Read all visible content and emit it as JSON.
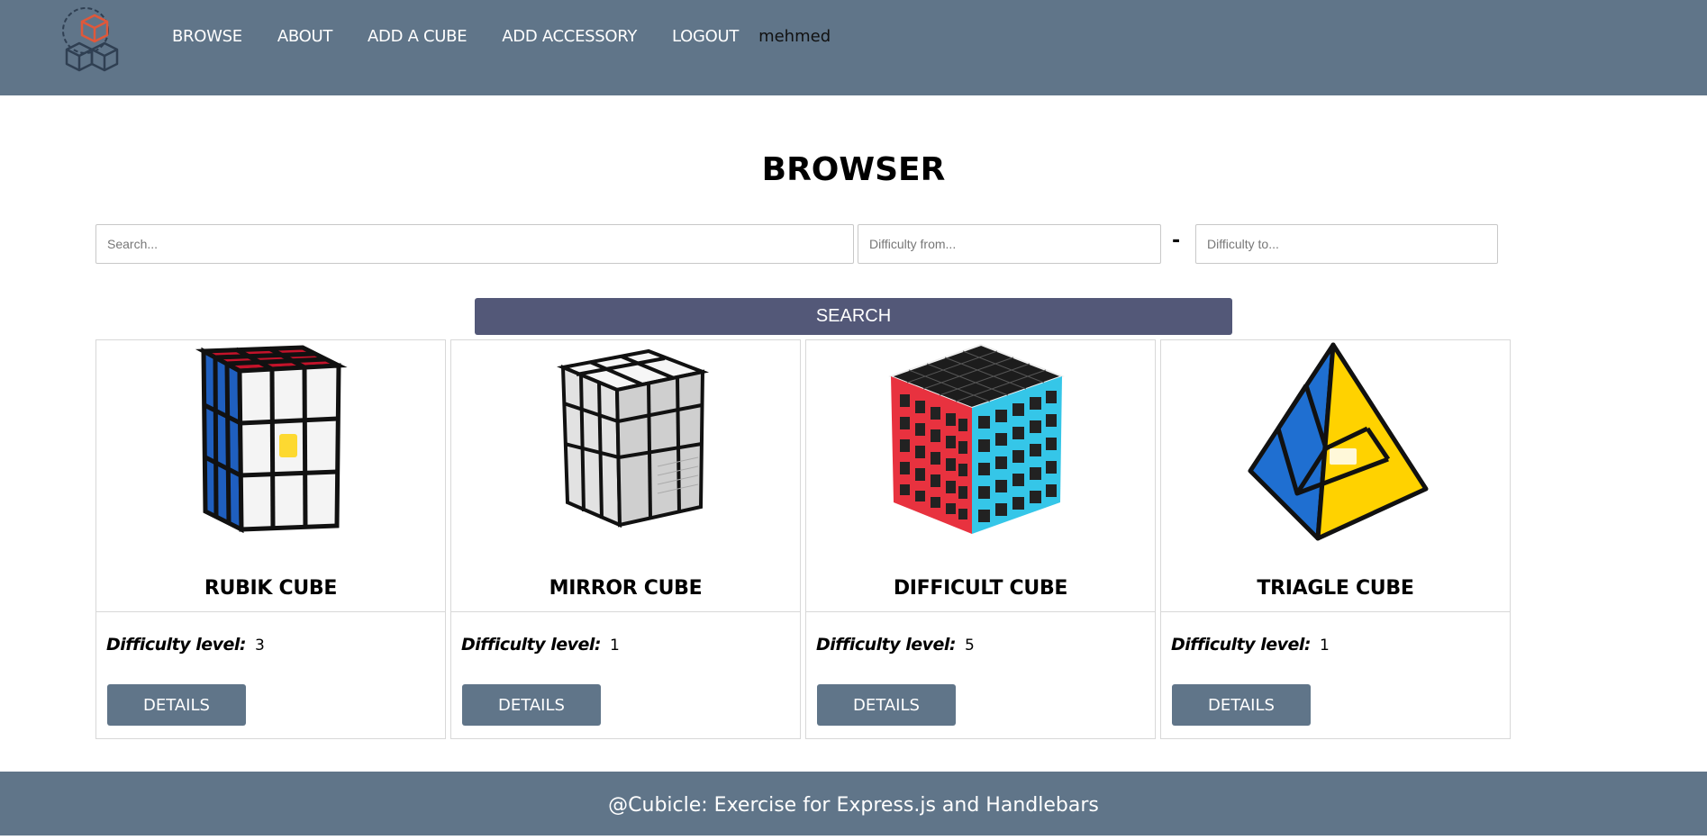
{
  "header": {
    "nav": [
      "BROWSE",
      "ABOUT",
      "ADD A CUBE",
      "ADD ACCESSORY",
      "LOGOUT"
    ],
    "username": "mehmed",
    "logo_icon": "cubes-logo-icon"
  },
  "main": {
    "title": "BROWSER",
    "search": {
      "placeholder": "Search...",
      "value": ""
    },
    "difficulty_from": {
      "placeholder": "Difficulty from...",
      "value": ""
    },
    "separator": "-",
    "difficulty_to": {
      "placeholder": "Difficulty to...",
      "value": ""
    },
    "search_button": "SEARCH"
  },
  "cards": [
    {
      "name": "RUBIK CUBE",
      "difficulty_label": "Difficulty level:",
      "difficulty": "3",
      "button": "DETAILS",
      "image_icon": "rubik-cube-image"
    },
    {
      "name": "MIRROR CUBE",
      "difficulty_label": "Difficulty level:",
      "difficulty": "1",
      "button": "DETAILS",
      "image_icon": "mirror-cube-image"
    },
    {
      "name": "DIFFICULT CUBE",
      "difficulty_label": "Difficulty level:",
      "difficulty": "5",
      "button": "DETAILS",
      "image_icon": "difficult-cube-image"
    },
    {
      "name": "TRIAGLE CUBE",
      "difficulty_label": "Difficulty level:",
      "difficulty": "1",
      "button": "DETAILS",
      "image_icon": "pyramid-cube-image"
    }
  ],
  "footer": {
    "text": "@Cubicle: Exercise for Express.js and Handlebars"
  },
  "colors": {
    "header": "#607589",
    "search_button": "#535878",
    "logo_accent": "#e0583a"
  }
}
